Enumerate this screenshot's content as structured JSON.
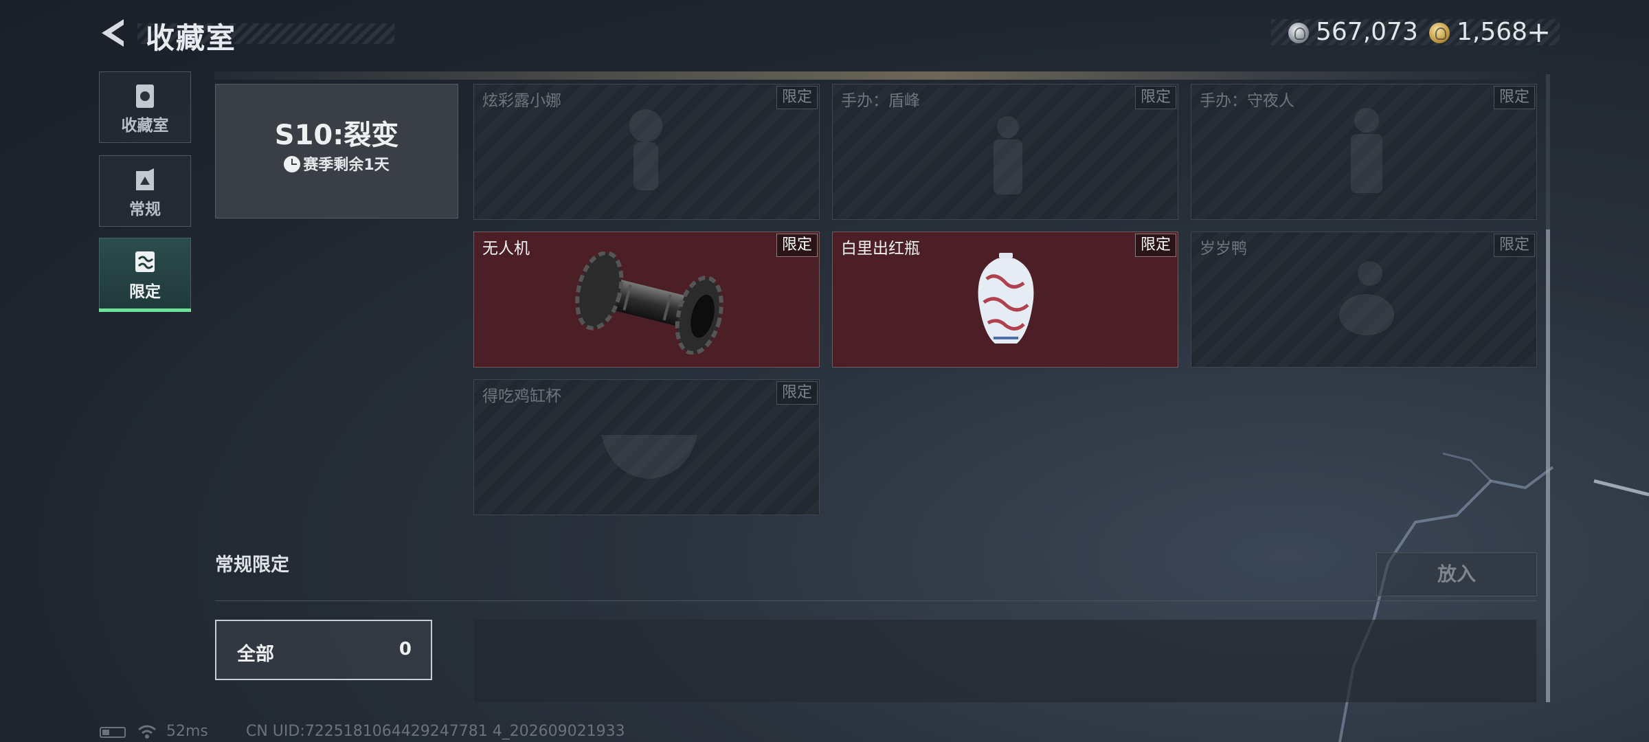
{
  "header": {
    "title": "收藏室"
  },
  "currency": {
    "silver": "567,073",
    "gold": "1,568",
    "plus": "+"
  },
  "sidebar": {
    "items": [
      {
        "label": "收藏室",
        "icon": "trash-can-icon"
      },
      {
        "label": "常规",
        "icon": "card-icon"
      },
      {
        "label": "限定",
        "icon": "limited-collection-icon",
        "active": true
      }
    ]
  },
  "season": {
    "title": "S10:裂变",
    "remaining": "赛季剩余1天"
  },
  "items": [
    {
      "name": "炫彩露小娜",
      "tag": "限定",
      "owned": false
    },
    {
      "name": "手办：盾峰",
      "tag": "限定",
      "owned": false
    },
    {
      "name": "手办：守夜人",
      "tag": "限定",
      "owned": false
    },
    {
      "name": "无人机",
      "tag": "限定",
      "owned": true
    },
    {
      "name": "白里出红瓶",
      "tag": "限定",
      "owned": true
    },
    {
      "name": "岁岁鸭",
      "tag": "限定",
      "owned": false
    },
    {
      "name": "得吃鸡缸杯",
      "tag": "限定",
      "owned": false
    }
  ],
  "regular": {
    "label": "常规限定",
    "put_button": "放入",
    "filter_all": "全部",
    "filter_count": "0"
  },
  "footer": {
    "ping": "52ms",
    "uid": "CN UID:7225181064429247781 4_202609021933"
  },
  "colors": {
    "accent": "#6fe39a",
    "owned_bg": "#4c1f26"
  }
}
